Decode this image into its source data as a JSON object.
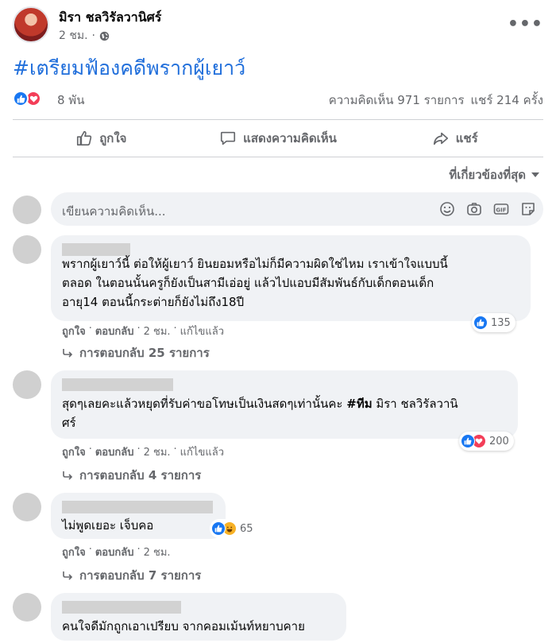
{
  "post": {
    "author": "มิรา ชลวิรัลวานิศร์",
    "time": "2 ชม.",
    "separator": "·",
    "hashtag": "#เตรียมฟ้องคดีพรากผู้เยาว์"
  },
  "stats": {
    "reactions": "8 พัน",
    "comments": "ความคิดเห็น 971 รายการ",
    "shares": "แชร์ 214 ครั้ง"
  },
  "actions": {
    "like": "ถูกใจ",
    "comment": "แสดงความคิดเห็น",
    "share": "แชร์"
  },
  "sort_label": "ที่เกี่ยวข้องที่สุด",
  "composer": {
    "placeholder": "เขียนความคิดเห็น..."
  },
  "comments": [
    {
      "text": "พรากผู้เยาว์นี้ ต่อให้ผู้เยาว์ ยินยอมหรือไม่ก็มีความผิดใช่ไหม เราเข้าใจแบบนี้ตลอด ในตอนนั้นครูก็ยังเป็นสามีเอ่อยู่ แล้วไปแอบมีสัมพันธ์กับเด็กตอนเด็กอายุ14 ตอนนี้กระต่ายก็ยังไม่ถึง18ปี",
      "line1": "พรากผู้เยาว์นี้ ต่อให้ผู้เยาว์ ยินยอมหรือไม่ก็มีความผิดใช่ไหม เราเข้าใจแบบนี้",
      "line2": "ตลอด ในตอนนั้นครูก็ยังเป็นสามีเอ่อยู่ แล้วไปแอบมีสัมพันธ์กับเด็กตอนเด็ก",
      "line3": "อายุ14 ตอนนี้กระต่ายก็ยังไม่ถึง18ปี",
      "reaction_count": "135",
      "like": "ถูกใจ",
      "reply": "ตอบกลับ",
      "time": "2 ชม.",
      "edited": "แก้ไขแล้ว",
      "replies": "การตอบกลับ 25 รายการ"
    },
    {
      "text_before_tag": "สุดๆเลยคะแล้วหยุดที่รับค่าขอโทษเป็นเงินสดๆเท่านั้นคะ ",
      "tag": "#ทีม",
      "text_after_tag": " มิรา ชลวิรัลวานิ",
      "line2": "ศร์",
      "reaction_count": "200",
      "like": "ถูกใจ",
      "reply": "ตอบกลับ",
      "time": "2 ชม.",
      "edited": "แก้ไขแล้ว",
      "replies": "การตอบกลับ 4 รายการ"
    },
    {
      "text": "ไม่พูดเยอะ เจ็บคอ",
      "reaction_count": "65",
      "like": "ถูกใจ",
      "reply": "ตอบกลับ",
      "time": "2 ชม.",
      "replies": "การตอบกลับ 7 รายการ"
    },
    {
      "text": "คนใจดีมักถูกเอาเปรียบ จากคอมเม้นท์หยาบคาย"
    }
  ],
  "colors": {
    "like_blue": "#1877f2",
    "love_red": "#f33e58",
    "haha_yellow": "#f7b125",
    "hashtag_blue": "#216fdb"
  }
}
